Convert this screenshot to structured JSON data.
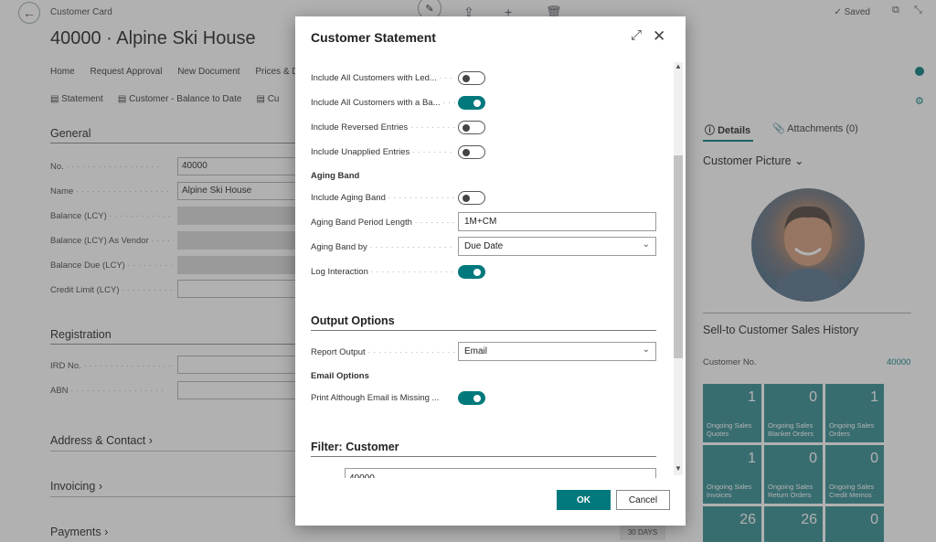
{
  "page": {
    "breadcrumb": "Customer Card",
    "title": "40000 · Alpine Ski House",
    "saved": "Saved",
    "actions": [
      "Home",
      "Request Approval",
      "New Document",
      "Prices & D"
    ],
    "actions2": [
      "Statement",
      "Customer - Balance to Date",
      "Cu"
    ],
    "general": {
      "heading": "General",
      "fields": [
        {
          "label": "No.",
          "value": "40000"
        },
        {
          "label": "Name",
          "value": "Alpine Ski House"
        },
        {
          "label": "Balance (LCY)",
          "value": ""
        },
        {
          "label": "Balance (LCY) As Vendor",
          "value": ""
        },
        {
          "label": "Balance Due (LCY)",
          "value": ""
        },
        {
          "label": "Credit Limit (LCY)",
          "value": ""
        }
      ]
    },
    "registration": {
      "heading": "Registration",
      "fields": [
        {
          "label": "IRD No.",
          "value": ""
        },
        {
          "label": "ABN",
          "value": ""
        }
      ]
    },
    "collapsed_sections": [
      "Address & Contact",
      "Invoicing",
      "Payments"
    ],
    "payments_badge": "30 DAYS",
    "factbox": {
      "tab_details": "Details",
      "tab_attachments": "Attachments (0)",
      "customer_picture": "Customer Picture",
      "sales_history_title": "Sell-to Customer Sales History",
      "customer_no_label": "Customer No.",
      "customer_no_value": "40000",
      "tiles": [
        {
          "value": "1",
          "label": "Ongoing Sales Quotes"
        },
        {
          "value": "0",
          "label": "Ongoing Sales Blanket Orders"
        },
        {
          "value": "1",
          "label": "Ongoing Sales Orders"
        },
        {
          "value": "1",
          "label": "Ongoing Sales Invoices"
        },
        {
          "value": "0",
          "label": "Ongoing Sales Return Orders"
        },
        {
          "value": "0",
          "label": "Ongoing Sales Credit Memos"
        },
        {
          "value": "26",
          "label": ""
        },
        {
          "value": "26",
          "label": ""
        },
        {
          "value": "0",
          "label": ""
        }
      ]
    }
  },
  "dialog": {
    "title": "Customer Statement",
    "options": {
      "include_all_ledger": {
        "label": "Include All Customers with Led...",
        "on": false
      },
      "include_all_balance": {
        "label": "Include All Customers with a Ba...",
        "on": true
      },
      "include_reversed": {
        "label": "Include Reversed Entries",
        "on": false
      },
      "include_unapplied": {
        "label": "Include Unapplied Entries",
        "on": false
      },
      "aging_band_head": "Aging Band",
      "include_aging_band": {
        "label": "Include Aging Band",
        "on": false
      },
      "aging_period_length": {
        "label": "Aging Band Period Length",
        "value": "1M+CM"
      },
      "aging_band_by": {
        "label": "Aging Band by",
        "value": "Due Date"
      },
      "log_interaction": {
        "label": "Log Interaction",
        "on": true
      }
    },
    "output": {
      "heading": "Output Options",
      "report_output": {
        "label": "Report Output",
        "value": "Email"
      },
      "email_options_head": "Email Options",
      "print_missing_email": {
        "label": "Print Although Email is Missing ...",
        "on": true
      }
    },
    "filter": {
      "heading": "Filter: Customer",
      "partial_value": "40000"
    },
    "ok_label": "OK",
    "cancel_label": "Cancel"
  },
  "colors": {
    "accent": "#00797d",
    "tile": "#2f8a8f"
  }
}
